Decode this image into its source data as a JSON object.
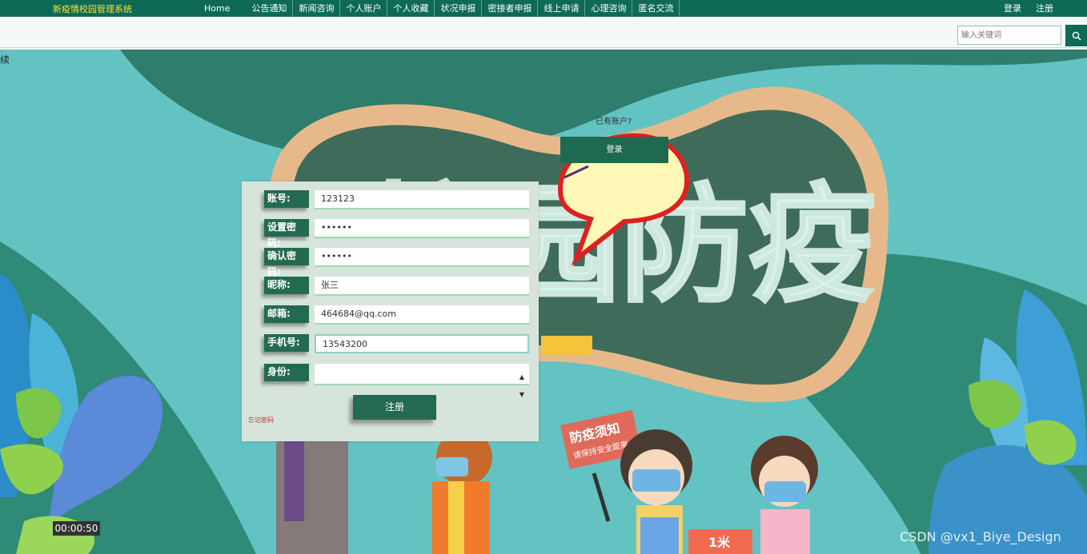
{
  "header": {
    "brand": "新疫情校园管理系统",
    "nav": [
      "Home",
      "公告通知",
      "新闻咨询",
      "个人账户",
      "个人收藏",
      "状况申报",
      "密接者申报",
      "线上申请",
      "心理咨询",
      "匿名交流"
    ],
    "auth": {
      "login": "登录",
      "register": "注册"
    }
  },
  "search": {
    "placeholder": "输入关键词",
    "icon": "search-icon"
  },
  "side_label": "续",
  "banner": {
    "title": "校园防疫",
    "sign_line1": "防疫须知",
    "sign_line2": "请保持安全距离",
    "floor_mark": "1米"
  },
  "bubble": {
    "question": "已有账户?",
    "login_button": "登录"
  },
  "form": {
    "fields": [
      {
        "label": "账号:",
        "value": "123123"
      },
      {
        "label": "设置密码:",
        "value": "••••••"
      },
      {
        "label": "确认密码:",
        "value": "••••••"
      },
      {
        "label": "昵称:",
        "value": "张三"
      },
      {
        "label": "邮箱:",
        "value": "464684@qq.com"
      },
      {
        "label": "手机号:",
        "value": "13543200"
      },
      {
        "label": "身份:",
        "value": ""
      }
    ],
    "register_button": "注册",
    "forgot_link": "忘记密码"
  },
  "video_timer": "00:00:50",
  "watermark": "CSDN @vx1_Biye_Design",
  "colors": {
    "primary": "#0e6a55",
    "brand_text": "#f3e23a",
    "form_bg": "#d6e4dc",
    "banner_bg": "#63c3c2"
  }
}
